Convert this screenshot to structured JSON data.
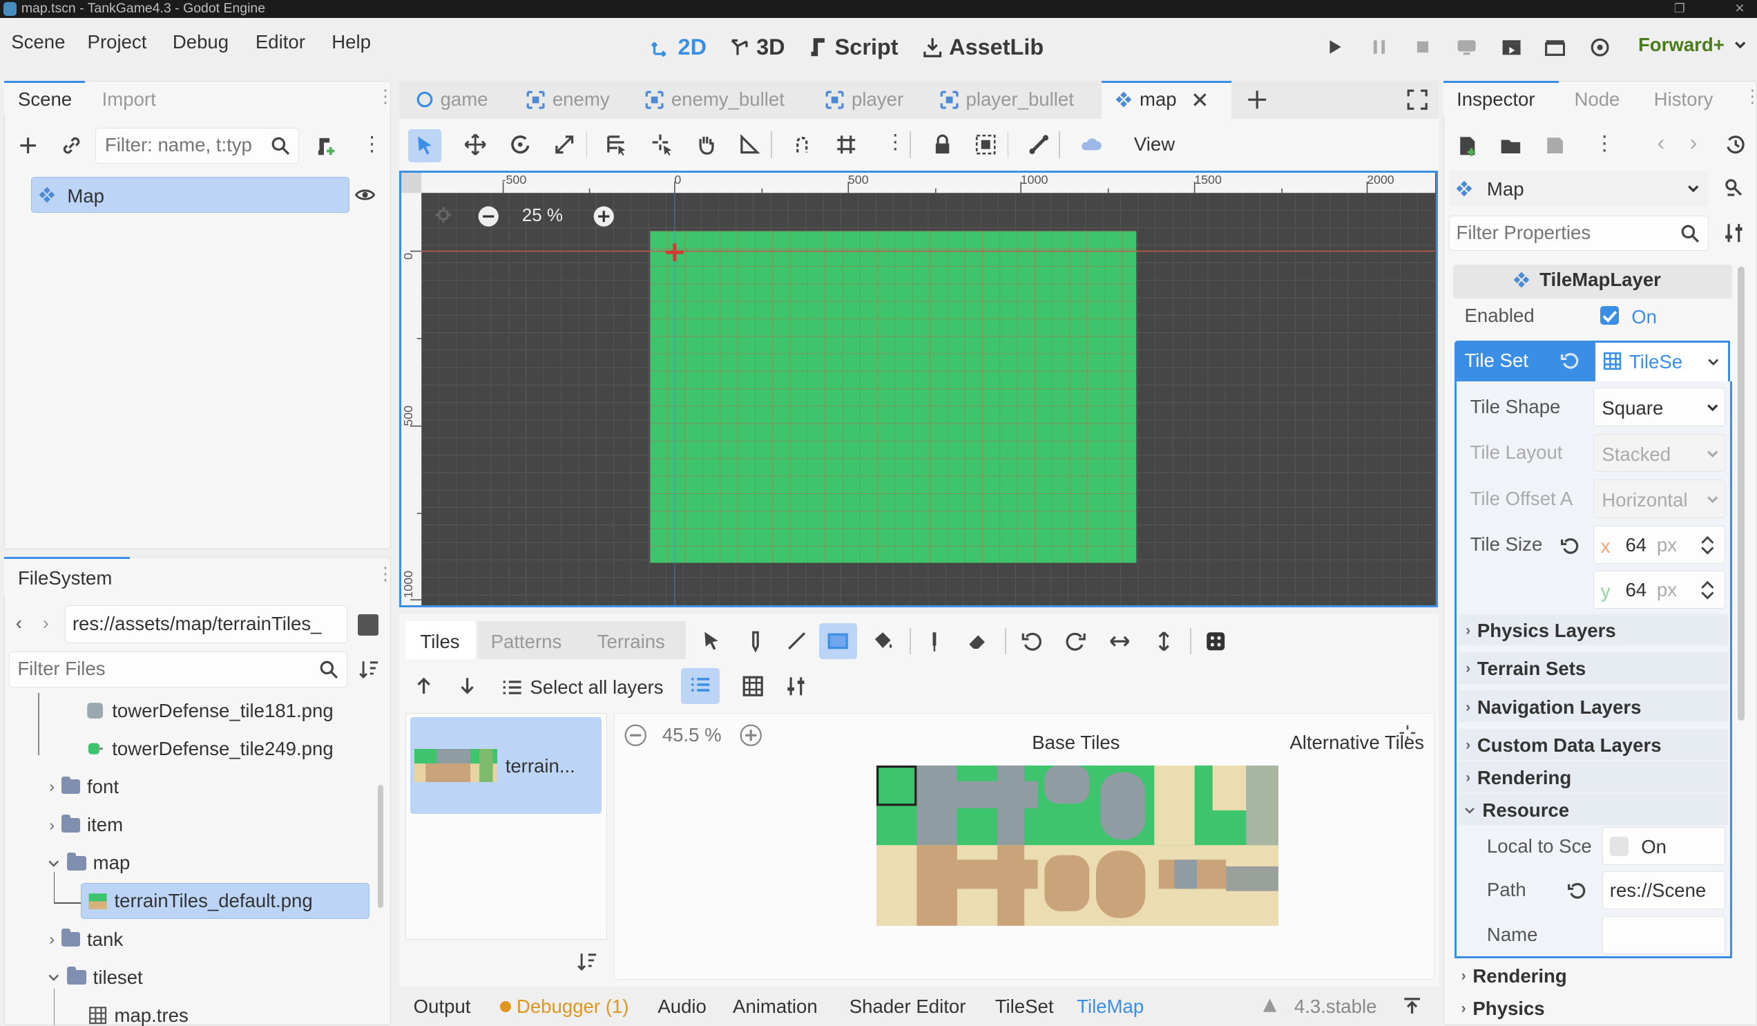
{
  "window": {
    "title": "map.tscn - TankGame4.3 - Godot Engine"
  },
  "menu": [
    "Scene",
    "Project",
    "Debug",
    "Editor",
    "Help"
  ],
  "workspaces": [
    {
      "label": "2D",
      "icon": "2d-icon",
      "active": true
    },
    {
      "label": "3D",
      "icon": "3d-icon",
      "active": false
    },
    {
      "label": "Script",
      "icon": "script-icon",
      "active": false
    },
    {
      "label": "AssetLib",
      "icon": "assetlib-icon",
      "active": false
    }
  ],
  "renderer": "Forward+",
  "scene_dock": {
    "tabs": [
      "Scene",
      "Import"
    ],
    "filter_placeholder": "Filter: name, t:typ",
    "root_node": "Map"
  },
  "filesystem": {
    "tab": "FileSystem",
    "path": "res://assets/map/terrainTiles_",
    "filter_placeholder": "Filter Files",
    "items": [
      {
        "label": "towerDefense_tile181.png",
        "type": "file"
      },
      {
        "label": "towerDefense_tile249.png",
        "type": "file"
      },
      {
        "label": "font",
        "type": "folder"
      },
      {
        "label": "item",
        "type": "folder"
      },
      {
        "label": "map",
        "type": "folder"
      },
      {
        "label": "terrainTiles_default.png",
        "type": "file",
        "selected": true
      },
      {
        "label": "tank",
        "type": "folder"
      },
      {
        "label": "tileset",
        "type": "folder"
      },
      {
        "label": "map.tres",
        "type": "file"
      }
    ]
  },
  "editor_tabs": [
    "game",
    "enemy",
    "enemy_bullet",
    "player",
    "player_bullet",
    "map"
  ],
  "active_editor_tab": "map",
  "toolbar": {
    "view_label": "View"
  },
  "viewport": {
    "zoom": "25 %",
    "ruler_h": [
      "-500",
      "0",
      "500",
      "1000",
      "1500",
      "2000"
    ],
    "ruler_v": [
      "0",
      "500",
      "1000"
    ]
  },
  "tilemap_panel": {
    "tabs": [
      "Tiles",
      "Patterns",
      "Terrains"
    ],
    "select_all_layers": "Select all layers",
    "source_name": "terrain...",
    "zoom": "45.5 %",
    "base_tiles": "Base Tiles",
    "alternative_tiles": "Alternative Tiles"
  },
  "bottom_bar": {
    "tabs": [
      "Output",
      "Debugger (1)",
      "Audio",
      "Animation",
      "Shader Editor",
      "TileSet",
      "TileMap"
    ],
    "active": "TileMap",
    "version": "4.3.stable"
  },
  "inspector": {
    "tabs": [
      "Inspector",
      "Node",
      "History"
    ],
    "object": "Map",
    "filter_placeholder": "Filter Properties",
    "class_header": "TileMapLayer",
    "enabled_label": "Enabled",
    "enabled_value": "On",
    "tile_set_label": "Tile Set",
    "tile_set_value": "TileSe",
    "tile_shape_label": "Tile Shape",
    "tile_shape_value": "Square",
    "tile_layout_label": "Tile Layout",
    "tile_layout_value": "Stacked",
    "tile_offset_label": "Tile Offset A",
    "tile_offset_value": "Horizontal",
    "tile_size_label": "Tile Size",
    "tile_size_x": "64",
    "tile_size_y": "64",
    "axis_x": "x",
    "axis_y": "y",
    "unit": "px",
    "sections": [
      "Physics Layers",
      "Terrain Sets",
      "Navigation Layers",
      "Custom Data Layers",
      "Rendering",
      "Resource"
    ],
    "local_to_scene_label": "Local to Sce",
    "local_to_scene_value": "On",
    "path_label": "Path",
    "path_value": "res://Scene",
    "name_label": "Name",
    "outer_sections": [
      "Rendering",
      "Physics"
    ]
  },
  "colors": {
    "accent": "#3b8ee6",
    "renderer": "#4b7c1a",
    "canvas_bg": "#464646",
    "map_fill": "#3ec46d",
    "debugger": "#e0961e"
  }
}
